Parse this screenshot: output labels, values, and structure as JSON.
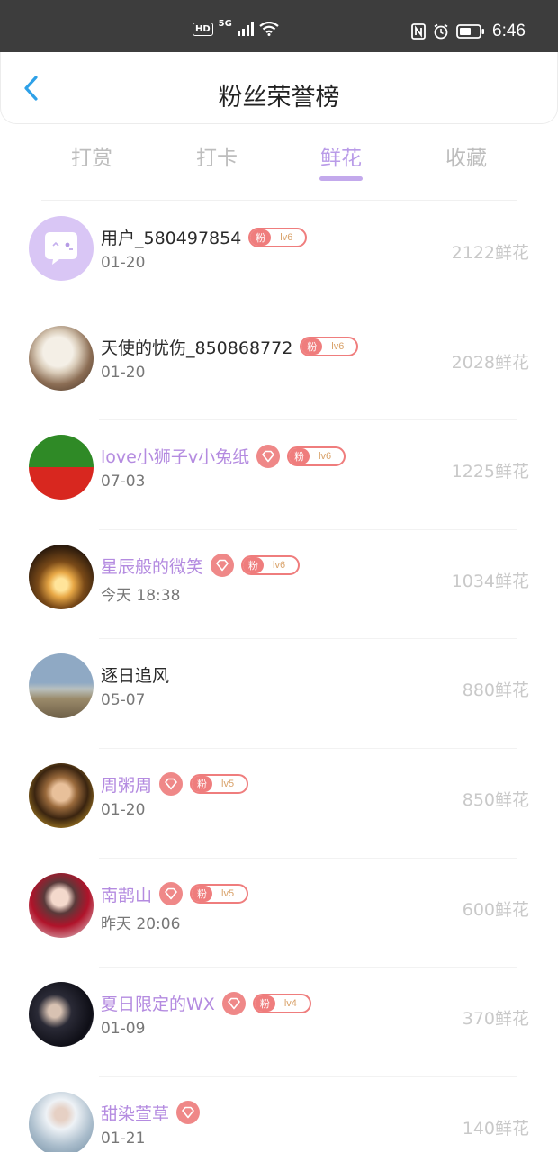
{
  "status_bar": {
    "hd": "HD",
    "network": "5G",
    "time": "6:46"
  },
  "header": {
    "title": "粉丝荣誉榜",
    "back_icon": "chevron-left-icon"
  },
  "tabs": [
    {
      "label": "打赏",
      "active": false
    },
    {
      "label": "打卡",
      "active": false
    },
    {
      "label": "鲜花",
      "active": true
    },
    {
      "label": "收藏",
      "active": false
    }
  ],
  "fans": [
    {
      "name": "用户_580497854",
      "date": "01-20",
      "count": "2122鲜花",
      "vip": false,
      "fan_label": "粉",
      "level": "lv6",
      "avatar": "chat-bubble-avatar"
    },
    {
      "name": "天使的忧伤_850868772",
      "date": "01-20",
      "count": "2028鲜花",
      "vip": false,
      "fan_label": "粉",
      "level": "lv6",
      "avatar": "flowers-photo-avatar"
    },
    {
      "name": "love小狮子v小兔纸",
      "date": "07-03",
      "count": "1225鲜花",
      "vip": true,
      "fan_label": "粉",
      "level": "lv6",
      "avatar": "green-red-avatar"
    },
    {
      "name": "星辰般的微笑",
      "date": "今天 18:38",
      "count": "1034鲜花",
      "vip": true,
      "fan_label": "粉",
      "level": "lv6",
      "avatar": "candle-lights-avatar"
    },
    {
      "name": "逐日追风",
      "date": "05-07",
      "count": "880鲜花",
      "vip": false,
      "fan_label": "",
      "level": "",
      "avatar": "horse-landscape-avatar"
    },
    {
      "name": "周粥周",
      "date": "01-20",
      "count": "850鲜花",
      "vip": true,
      "fan_label": "粉",
      "level": "lv5",
      "avatar": "portrait-avatar"
    },
    {
      "name": "南鹊山",
      "date": "昨天 20:06",
      "count": "600鲜花",
      "vip": true,
      "fan_label": "粉",
      "level": "lv5",
      "avatar": "red-portrait-avatar"
    },
    {
      "name": "夏日限定的WX",
      "date": "01-09",
      "count": "370鲜花",
      "vip": true,
      "fan_label": "粉",
      "level": "lv4",
      "avatar": "dark-portrait-avatar"
    },
    {
      "name": "甜染萱草",
      "date": "01-21",
      "count": "140鲜花",
      "vip": true,
      "fan_label": "",
      "level": "",
      "avatar": "white-costume-avatar"
    }
  ],
  "colors": {
    "accent": "#b99be8",
    "vip_name": "#b48be0",
    "badge_red": "#ef7d7d",
    "count_grey": "#c9c9c9"
  }
}
